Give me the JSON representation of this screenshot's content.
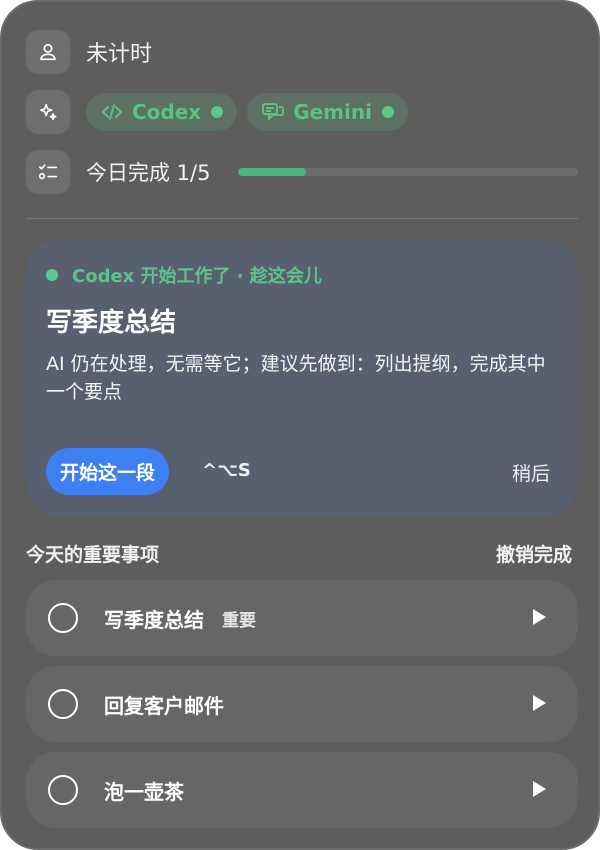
{
  "status": {
    "timer_text": "未计时",
    "user_icon": "user-icon"
  },
  "agents": {
    "sparkle_icon": "sparkle-icon",
    "chips": [
      {
        "label": "Codex",
        "icon": "code-icon",
        "online": true
      },
      {
        "label": "Gemini",
        "icon": "chat-icon",
        "online": true
      }
    ]
  },
  "progress": {
    "label": "今日完成 1/5",
    "done": 1,
    "total": 5,
    "fraction": 0.2,
    "icon": "checklist-icon"
  },
  "focus_card": {
    "status": "Codex 开始工作了 · 趁这会儿",
    "title": "写季度总结",
    "description": "AI 仍在处理，无需等它；建议先做到：列出提纲，完成其中一个要点",
    "start_button": "开始这一段",
    "shortcut": "^⌥S",
    "later_button": "稍后"
  },
  "important": {
    "title": "今天的重要事项",
    "undo_label": "撤销完成",
    "tasks": [
      {
        "title": "写季度总结",
        "tag": "重要"
      },
      {
        "title": "回复客户邮件",
        "tag": ""
      },
      {
        "title": "泡一壶茶",
        "tag": ""
      }
    ]
  },
  "colors": {
    "accent_green": "#5cc98c",
    "button_blue": "#3e7ff2",
    "card_bg": "#58606f",
    "panel_bg": "#5d5d5d"
  }
}
